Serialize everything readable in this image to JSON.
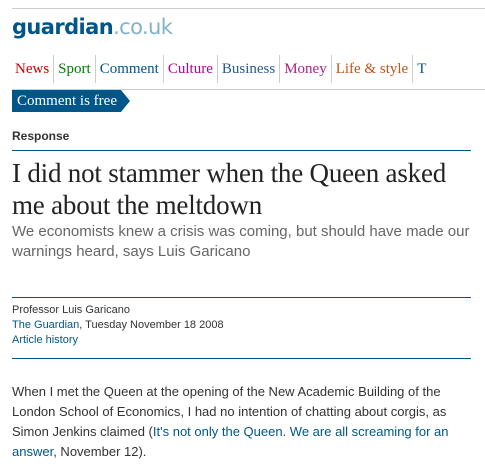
{
  "masthead": {
    "logo_main": "guardian",
    "logo_domain": ".co.uk"
  },
  "nav": {
    "items": [
      {
        "label": "News",
        "color": "#cc0000"
      },
      {
        "label": "Sport",
        "color": "#008000"
      },
      {
        "label": "Comment",
        "color": "#005689"
      },
      {
        "label": "Culture",
        "color": "#b5009a"
      },
      {
        "label": "Business",
        "color": "#29598c"
      },
      {
        "label": "Money",
        "color": "#aa2288"
      },
      {
        "label": "Life & style",
        "color": "#c0561a"
      },
      {
        "label": "T",
        "color": "#005689"
      }
    ]
  },
  "section": {
    "label": "Comment is free"
  },
  "article": {
    "kicker": "Response",
    "headline": "I did not stammer when the Queen asked me about the meltdown",
    "standfirst": "We economists knew a crisis was coming, but should have made our warnings heard, says Luis Garicano",
    "author": "Professor Luis Garicano",
    "publication": "The Guardian",
    "date": ", Tuesday November 18 2008",
    "history_link": "Article history",
    "body": {
      "text_before": "When I met the Queen at the opening of the New Academic Building of the London School of Economics, I had no intention of chatting about corgis, as Simon Jenkins claimed (",
      "link_text": "It's not only the Queen. We are all screaming for an answer",
      "text_after": ", November 12)."
    }
  }
}
